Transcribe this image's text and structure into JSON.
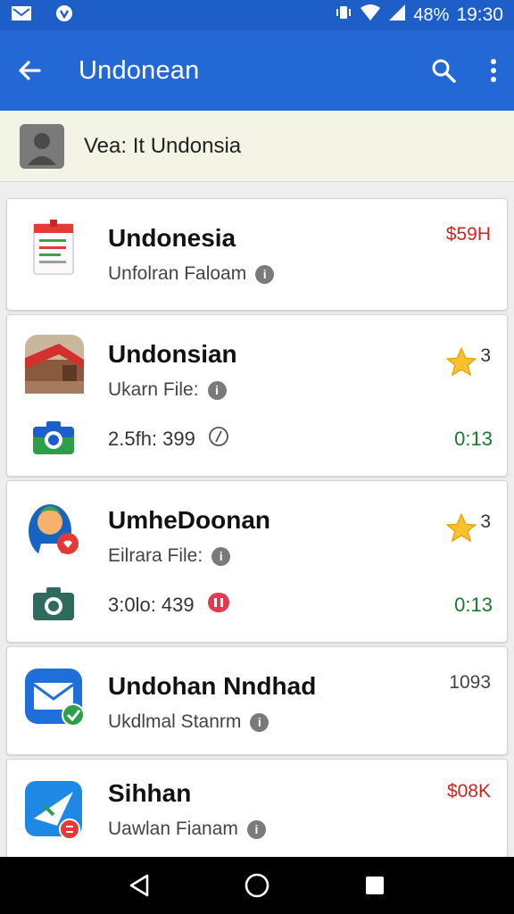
{
  "status_bar": {
    "time": "19:30",
    "battery": "48%",
    "left_icons": [
      "gmail-icon",
      "vpn-icon"
    ],
    "right_icons": [
      "vibrate-icon",
      "wifi-icon",
      "signal-icon"
    ]
  },
  "app_bar": {
    "title": "Undonean",
    "back_icon": "arrow-left-icon",
    "search_icon": "search-icon",
    "more_icon": "more-vert-icon"
  },
  "banner": {
    "text": "Vea: It Undonsia"
  },
  "items": [
    {
      "title": "Undonesia",
      "subtitle": "Unfolran Faloam",
      "value": "$59H",
      "value_color": "#d32222",
      "icon": "document-icon"
    },
    {
      "title": "Undonsian",
      "subtitle": "Ukarn File:",
      "rating": "3",
      "meta_text": "2.5fh: 399",
      "meta_time": "0:13",
      "icon": "house-photo-icon",
      "meta_icon": "camera-icon"
    },
    {
      "title": "UmheDoonan",
      "subtitle": "Eilrara File:",
      "rating": "3",
      "meta_text": "3:0lo: 439",
      "meta_time": "0:13",
      "icon": "person-icon",
      "meta_icon": "camera-icon"
    },
    {
      "title": "Undohan Nndhad",
      "subtitle": "Ukdlmal Stanrm",
      "value": "1093",
      "value_color": "#444444",
      "icon": "mail-icon"
    },
    {
      "title": "Sihhan",
      "subtitle": "Uawlan Fianam",
      "value": "$08K",
      "value_color": "#d32222",
      "icon": "send-icon"
    }
  ],
  "nav_bar": {
    "back": "nav-back-icon",
    "home": "nav-home-icon",
    "recents": "nav-recents-icon"
  },
  "colors": {
    "app_bar": "#2468d6",
    "status_bar": "#1e5ec8",
    "accent_green": "#1a7a2e",
    "accent_red": "#d32222"
  }
}
